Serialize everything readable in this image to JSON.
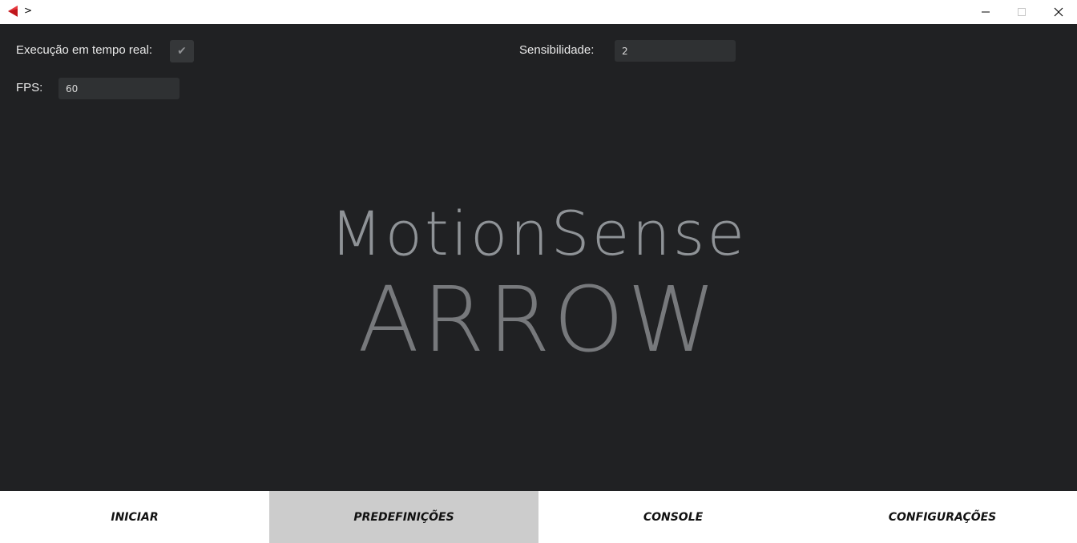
{
  "window": {
    "title": ">",
    "icon": "red-arrow-left-icon"
  },
  "settings": {
    "realtime_label": "Execução em tempo real:",
    "realtime_checked": true,
    "check_glyph": "✔",
    "sensitivity_label": "Sensibilidade:",
    "sensitivity_value": "2",
    "fps_label": "FPS:",
    "fps_value": "60"
  },
  "logo": {
    "line1": "MotionSense",
    "line2": "ARROW"
  },
  "nav": {
    "tabs": [
      {
        "label": "INICIAR",
        "active": false
      },
      {
        "label": "PREDEFINIÇÕES",
        "active": true
      },
      {
        "label": "CONSOLE",
        "active": false
      },
      {
        "label": "CONFIGURAÇÕES",
        "active": false
      }
    ]
  },
  "colors": {
    "background": "#202123",
    "field": "#2f3133",
    "active_tab": "#cccccc",
    "icon_red": "#c0161b"
  }
}
